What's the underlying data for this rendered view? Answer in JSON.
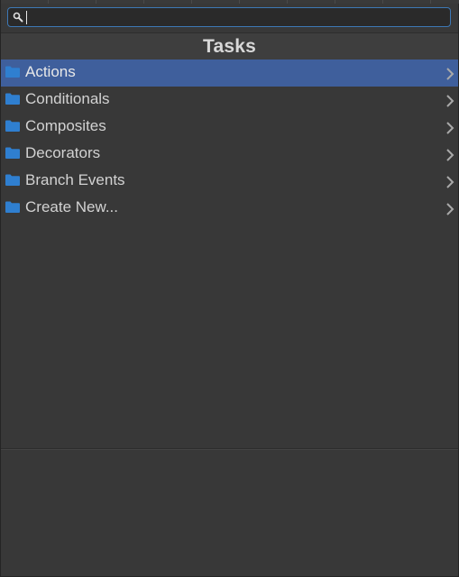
{
  "search": {
    "value": "",
    "placeholder": ""
  },
  "header": {
    "title": "Tasks"
  },
  "tasks": {
    "items": [
      {
        "label": "Actions",
        "icon": "folder-icon",
        "selected": true
      },
      {
        "label": "Conditionals",
        "icon": "folder-icon",
        "selected": false
      },
      {
        "label": "Composites",
        "icon": "folder-icon",
        "selected": false
      },
      {
        "label": "Decorators",
        "icon": "folder-icon",
        "selected": false
      },
      {
        "label": "Branch Events",
        "icon": "folder-icon",
        "selected": false
      },
      {
        "label": "Create New...",
        "icon": "folder-icon",
        "selected": false
      }
    ]
  },
  "colors": {
    "background": "#383838",
    "selection": "#3f5f9c",
    "focus_border": "#3d78b5",
    "folder": "#2f7fd0",
    "text": "#d2d2d2"
  }
}
